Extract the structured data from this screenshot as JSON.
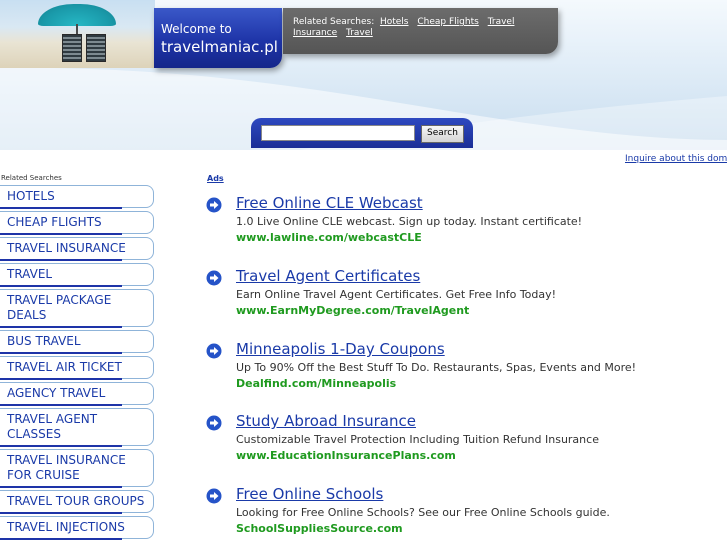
{
  "header": {
    "welcome": "Welcome to",
    "domain": "travelmaniac.pl",
    "related_prefix": "Related Searches:",
    "related_links": [
      "Hotels",
      "Cheap Flights",
      "Travel Insurance",
      "Travel"
    ]
  },
  "search": {
    "button": "Search",
    "value": ""
  },
  "inquire": "Inquire about this domain",
  "sidebar": {
    "title": "Related Searches",
    "items": [
      "HOTELS",
      "CHEAP FLIGHTS",
      "TRAVEL INSURANCE",
      "TRAVEL",
      "TRAVEL PACKAGE DEALS",
      "BUS TRAVEL",
      "TRAVEL AIR TICKET",
      "AGENCY TRAVEL",
      "TRAVEL AGENT CLASSES",
      "TRAVEL INSURANCE FOR CRUISE",
      "TRAVEL TOUR GROUPS",
      "TRAVEL INJECTIONS"
    ]
  },
  "ads": {
    "label": "Ads",
    "icon": "arrow-circle-icon",
    "items": [
      {
        "title": "Free Online CLE Webcast",
        "desc": "1.0 Live Online CLE webcast. Sign up today. Instant certificate!",
        "url": "www.lawline.com/webcastCLE"
      },
      {
        "title": "Travel Agent Certificates",
        "desc": "Earn Online Travel Agent Certificates. Get Free Info Today!",
        "url": "www.EarnMyDegree.com/TravelAgent"
      },
      {
        "title": "Minneapolis 1-Day Coupons",
        "desc": "Up To 90% Off the Best Stuff To Do. Restaurants, Spas, Events and More!",
        "url": "Dealfind.com/Minneapolis"
      },
      {
        "title": "Study Abroad Insurance",
        "desc": "Customizable Travel Protection Including Tuition Refund Insurance",
        "url": "www.EducationInsurancePlans.com"
      },
      {
        "title": "Free Online Schools",
        "desc": "Looking for Free Online Schools? See our Free Online Schools guide.",
        "url": "SchoolSuppliesSource.com"
      }
    ]
  },
  "colors": {
    "link": "#1a3aa8",
    "url": "#1f9a1f",
    "header_blue": "#1e34a8",
    "related_gray": "#5f5f5f"
  }
}
